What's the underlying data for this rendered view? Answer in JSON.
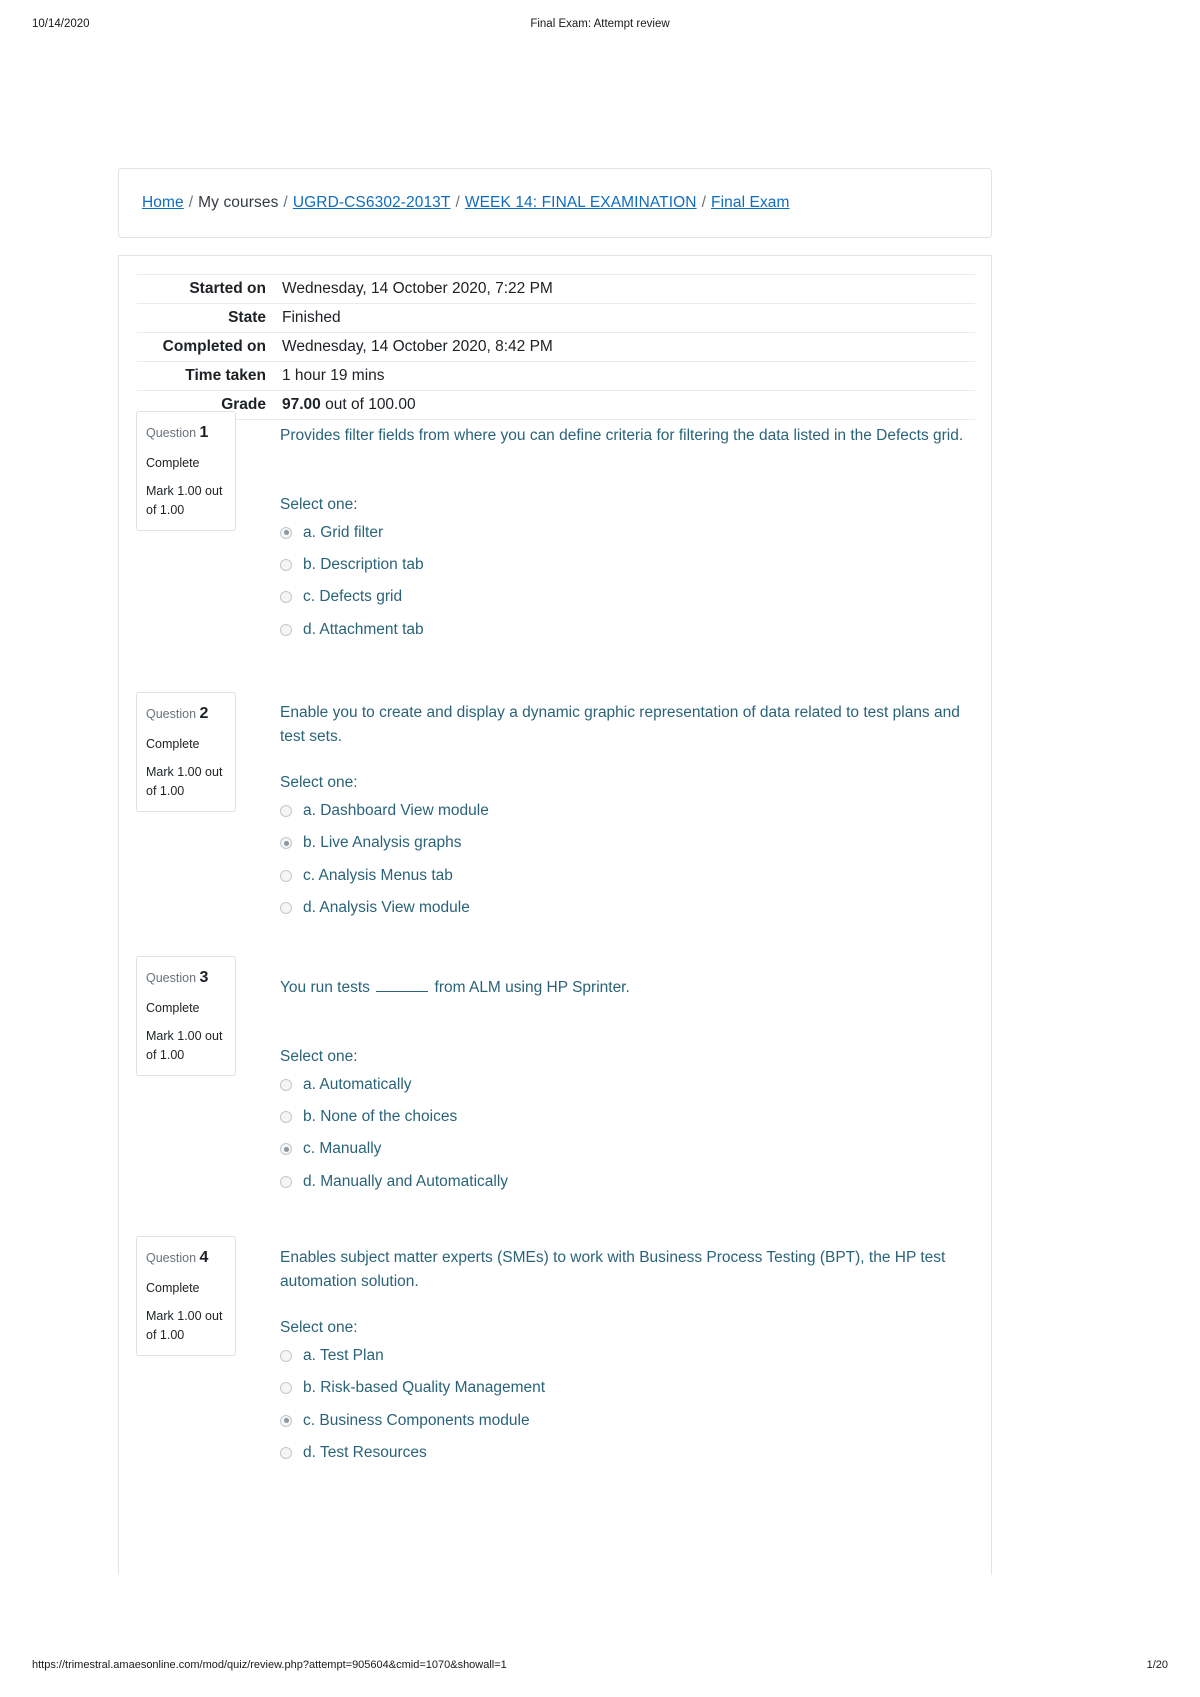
{
  "print_header": {
    "date": "10/14/2020",
    "title": "Final Exam: Attempt review"
  },
  "print_footer": {
    "url": "https://trimestral.amaesonline.com/mod/quiz/review.php?attempt=905604&cmid=1070&showall=1",
    "page": "1/20"
  },
  "breadcrumb": {
    "home": "Home",
    "my_courses": "My courses",
    "course": "UGRD-CS6302-2013T",
    "section": "WEEK 14: FINAL EXAMINATION",
    "activity": "Final Exam",
    "separator": "/"
  },
  "summary": {
    "rows": [
      {
        "label": "Started on",
        "value": "Wednesday, 14 October 2020, 7:22 PM"
      },
      {
        "label": "State",
        "value": "Finished"
      },
      {
        "label": "Completed on",
        "value": "Wednesday, 14 October 2020, 8:42 PM"
      },
      {
        "label": "Time taken",
        "value": "1 hour 19 mins"
      }
    ],
    "grade": {
      "label": "Grade",
      "score": "97.00",
      "suffix": "out of 100.00"
    }
  },
  "labels": {
    "question_word": "Question",
    "select_one": "Select one:"
  },
  "questions": [
    {
      "number": "1",
      "state": "Complete",
      "mark": "Mark 1.00 out of 1.00",
      "text": "Provides filter fields from where you can define criteria for filtering the data listed in the Defects grid.",
      "options": [
        {
          "label": "a. Grid filter",
          "selected": true
        },
        {
          "label": "b. Description tab",
          "selected": false
        },
        {
          "label": "c. Defects grid",
          "selected": false
        },
        {
          "label": "d. Attachment tab",
          "selected": false
        }
      ]
    },
    {
      "number": "2",
      "state": "Complete",
      "mark": "Mark 1.00 out of 1.00",
      "text": "Enable you to create and display a dynamic graphic representation of data related to test plans and test sets.",
      "options": [
        {
          "label": "a. Dashboard View module",
          "selected": false
        },
        {
          "label": "b. Live Analysis graphs",
          "selected": true
        },
        {
          "label": "c. Analysis Menus tab",
          "selected": false
        },
        {
          "label": "d. Analysis View module",
          "selected": false
        }
      ]
    },
    {
      "number": "3",
      "state": "Complete",
      "mark": "Mark 1.00 out of 1.00",
      "text_before": "You run tests",
      "text_after": "from ALM using HP Sprinter.",
      "has_blank": true,
      "options": [
        {
          "label": "a. Automatically",
          "selected": false
        },
        {
          "label": "b. None of the choices",
          "selected": false
        },
        {
          "label": "c. Manually",
          "selected": true
        },
        {
          "label": "d. Manually and Automatically",
          "selected": false
        }
      ]
    },
    {
      "number": "4",
      "state": "Complete",
      "mark": "Mark 1.00 out of 1.00",
      "text": "Enables subject matter experts (SMEs) to work with Business Process Testing (BPT), the HP test automation solution.",
      "options": [
        {
          "label": "a. Test Plan",
          "selected": false
        },
        {
          "label": "b. Risk-based Quality Management",
          "selected": false
        },
        {
          "label": "c. Business Components module",
          "selected": true
        },
        {
          "label": "d. Test Resources",
          "selected": false
        }
      ]
    }
  ]
}
